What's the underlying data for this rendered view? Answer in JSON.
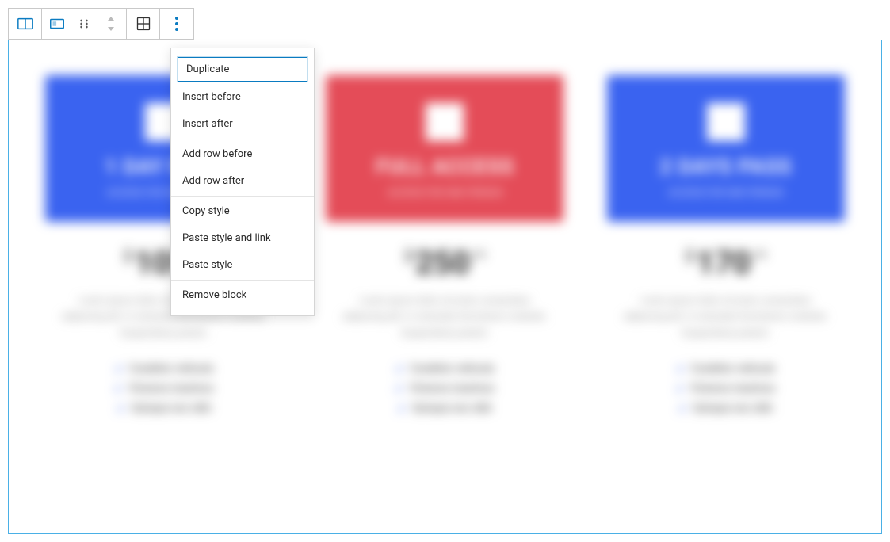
{
  "toolbar": {
    "icons": {
      "columns": "columns-icon",
      "container": "container-icon",
      "drag": "drag-handle-icon",
      "move": "move-arrows-icon",
      "grid": "grid-layout-icon",
      "more": "more-options-icon"
    }
  },
  "menu": {
    "group1": [
      "Duplicate",
      "Insert before",
      "Insert after"
    ],
    "group2": [
      "Add row before",
      "Add row after"
    ],
    "group3": [
      "Copy style",
      "Paste style and link",
      "Paste style"
    ],
    "group4": [
      "Remove block"
    ],
    "focused_index": 0
  },
  "cards": [
    {
      "color": "blue",
      "title": "1 DAY PASS",
      "subtitle": "ACCESS FOR ONE PERSON",
      "currency": "$",
      "amount": "105",
      "cents": "99",
      "lorem": "Lorem ipsum dolor sit amet, consectetur adipiscing elit. In venenatis fermentum molestie. Suspendisse potenti.",
      "features": [
        "Curabitur vehicula",
        "Vivamus maximus",
        "Quisque nec nibh"
      ]
    },
    {
      "color": "red",
      "title": "FULL ACCESS",
      "subtitle": "ACCESS FOR ONE PERSON",
      "currency": "$",
      "amount": "250",
      "cents": "99",
      "lorem": "Lorem ipsum dolor sit amet, consectetur adipiscing elit. In venenatis fermentum molestie. Suspendisse potenti.",
      "features": [
        "Curabitur vehicula",
        "Vivamus maximus",
        "Quisque nec nibh"
      ]
    },
    {
      "color": "blue",
      "title": "2 DAYS PASS",
      "subtitle": "ACCESS FOR ONE PERSON",
      "currency": "$",
      "amount": "170",
      "cents": "99",
      "lorem": "Lorem ipsum dolor sit amet, consectetur adipiscing elit. In venenatis fermentum molestie. Suspendisse potenti.",
      "features": [
        "Curabitur vehicula",
        "Vivamus maximus",
        "Quisque nec nibh"
      ]
    }
  ]
}
